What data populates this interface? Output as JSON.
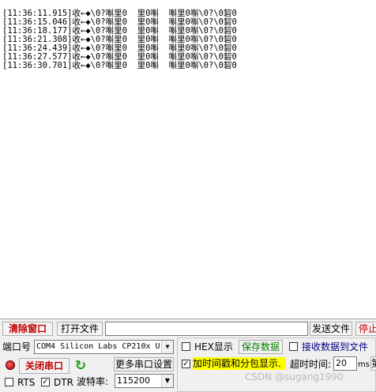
{
  "log": {
    "lines": [
      "[11:36:11.915]收←◆\\0?嘝里0  里0嘝  嘝里0嘝\\0?\\0䂮0",
      "[11:36:15.046]收←◆\\0?嘝里0  里0嘝  嘝里0嘝\\0?\\0䂮0",
      "[11:36:18.177]收←◆\\0?嘝里0  里0嘝  嘝里0嘝\\0?\\0䂮0",
      "[11:36:21.308]收←◆\\0?嘝里0  里0嘝  嘝里0嘝\\0?\\0䂮0",
      "[11:36:24.439]收←◆\\0?嘝里0  里0嘝  嘝里0嘝\\0?\\0䂮0",
      "[11:36:27.577]收←◆\\0?嘝里0  里0嘝  嘝里0嘝\\0?\\0䂮0",
      "[11:36:30.701]收←◆\\0?嘝里0  里0嘝  嘝里0嘝\\0?\\0䂮0"
    ]
  },
  "toolbar": {
    "clear_label": "清除窗口",
    "open_file_label": "打开文件",
    "file_path": "",
    "send_file_label": "发送文件",
    "stop_label": "停止"
  },
  "port": {
    "label": "端口号",
    "selected": "COM4 Silicon Labs CP210x U",
    "close_label": "关闭串口",
    "more_settings_label": "更多串口设置",
    "rts_label": "RTS",
    "rts_checked": false,
    "dtr_label": "DTR",
    "dtr_checked": true,
    "baud_label": "波特率:",
    "baud_value": "115200"
  },
  "options": {
    "hex_label": "HEX显示",
    "hex_checked": false,
    "save_data_label": "保存数据",
    "recv_to_file_label": "接收数据到文件",
    "recv_to_file_checked": false,
    "timestamp_label": "加时间戳和分包显示.",
    "timestamp_checked": true,
    "timeout_label": "超时时间:",
    "timeout_value": "20",
    "timeout_unit": "ms",
    "cut_label": "第"
  },
  "watermark": "CSDN @sugang1990",
  "colors": {
    "red_text": "#c00000",
    "green_text": "#008000",
    "highlight": "#ffff00"
  }
}
